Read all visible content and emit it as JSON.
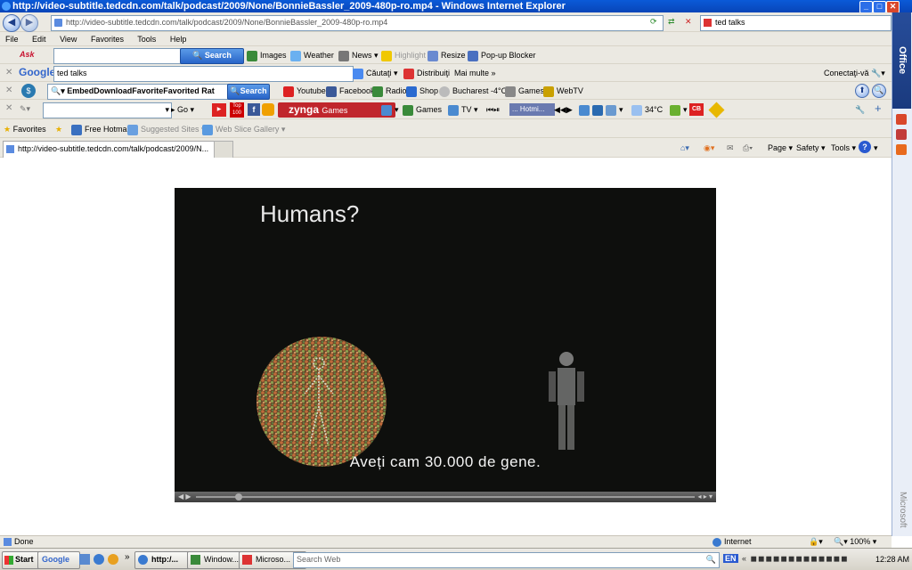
{
  "window": {
    "title": "http://video-subtitle.tedcdn.com/talk/podcast/2009/None/BonnieBassler_2009-480p-ro.mp4 - Windows Internet Explorer"
  },
  "address_bar": {
    "url": "http://video-subtitle.tedcdn.com/talk/podcast/2009/None/BonnieBassler_2009-480p-ro.mp4",
    "search_value": "ted talks"
  },
  "menu": {
    "file": "File",
    "edit": "Edit",
    "view": "View",
    "favorites": "Favorites",
    "tools": "Tools",
    "help": "Help"
  },
  "ask_toolbar": {
    "search_button": "Search",
    "images": "Images",
    "weather": "Weather",
    "news": "News",
    "highlight": "Highlight",
    "resize": "Resize",
    "popup_blocker": "Pop-up Blocker"
  },
  "google_toolbar": {
    "logo": "Google",
    "query": "ted talks",
    "search_button": "Căutaţi",
    "share": "Distribuiţi",
    "more": "Mai multe",
    "signin": "Conectaţi-vă"
  },
  "embed_toolbar": {
    "dropdown": "EmbedDownloadFavoriteFavorited Rat",
    "search_button": "Search",
    "youtube": "Youtube",
    "facebook": "Facebook",
    "radio": "Radio",
    "shop": "Shop",
    "weather": "Bucharest -4°C",
    "games": "Games",
    "webtv": "WebTV"
  },
  "zynga_toolbar": {
    "go": "Go",
    "zynga": "zynga",
    "zynga_games": "Games",
    "games": "Games",
    "tv": "TV",
    "hotmail": "... Hotmi...",
    "temp": "34°C",
    "top": "Top",
    "top_num": "100"
  },
  "favorites_bar": {
    "favorites": "Favorites",
    "free_hotmail": "Free Hotmail",
    "suggested": "Suggested Sites",
    "web_slice": "Web Slice Gallery"
  },
  "tab": {
    "label": "http://video-subtitle.tedcdn.com/talk/podcast/2009/N..."
  },
  "command_bar": {
    "page": "Page",
    "safety": "Safety",
    "tools": "Tools"
  },
  "video": {
    "title_text": "Humans?",
    "subtitle": "Aveți cam 30.000 de gene."
  },
  "sidebar": {
    "office": "Office",
    "microsoft": "Microsoft"
  },
  "status_bar": {
    "status": "Done",
    "zone": "Internet",
    "zoom": "100%"
  },
  "taskbar": {
    "start": "Start",
    "google": "Google",
    "task1": "http:/...",
    "task2": "Window...",
    "task3": "Microso...",
    "search_placeholder": "Search Web",
    "time": "12:28 AM",
    "lang": "EN"
  },
  "colors": {
    "title_bar": "#0a5ad8",
    "video_bg": "#0e0f0d",
    "search_blue": "#2864c8",
    "zynga_red": "#c0262c"
  }
}
